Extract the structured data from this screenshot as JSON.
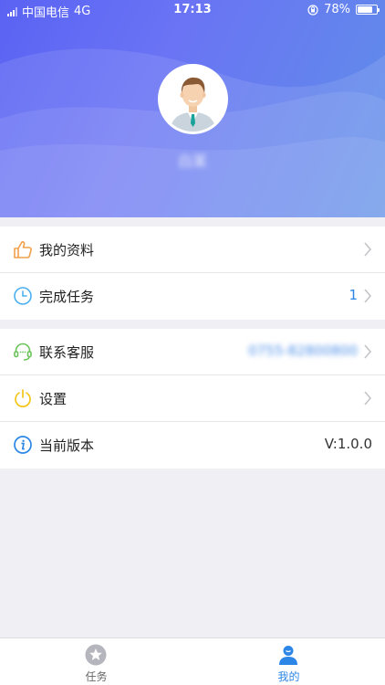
{
  "status_bar": {
    "carrier": "中国电信",
    "network": "4G",
    "time": "17:13",
    "battery": "78%",
    "battery_level": 0.78
  },
  "profile": {
    "username": "白某"
  },
  "menu_group_1": [
    {
      "label": "我的资料",
      "value": "",
      "icon": "thumbs-up-icon"
    },
    {
      "label": "完成任务",
      "value": "1",
      "icon": "clock-icon"
    }
  ],
  "menu_group_2": [
    {
      "label": "联系客服",
      "value": "0755-82800800",
      "icon": "headset-icon"
    },
    {
      "label": "设置",
      "value": "",
      "icon": "power-icon"
    },
    {
      "label": "当前版本",
      "value": "V:1.0.0",
      "icon": "info-icon"
    }
  ],
  "tabbar": {
    "tasks_label": "任务",
    "mine_label": "我的"
  },
  "colors": {
    "accent": "#2b86e6",
    "header_start": "#5a63f3",
    "header_end": "#5f8fe8",
    "tab_inactive": "#b5b5bd"
  }
}
